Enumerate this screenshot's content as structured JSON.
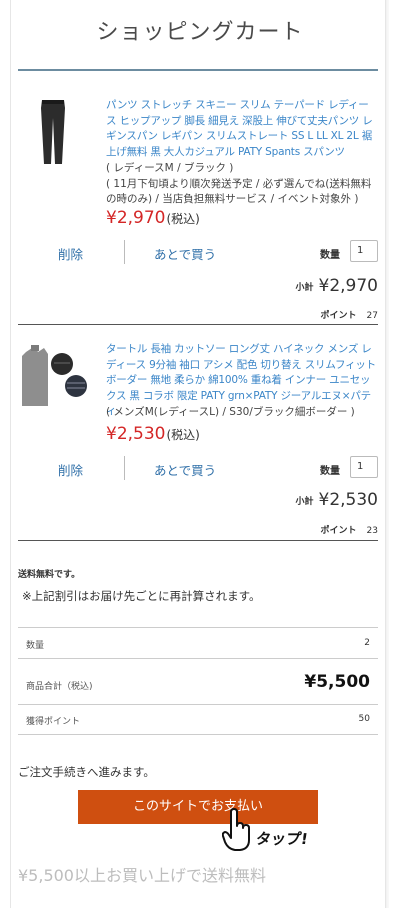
{
  "page": {
    "title": "ショッピングカート"
  },
  "items": [
    {
      "name": "パンツ ストレッチ スキニー スリム テーパード レディース ヒップアップ 脚長 細見え 深股上 伸びて丈夫パンツ レギンスパン レギパン スリムストレート SS L LL XL 2L 裾上げ無料 黒 大人カジュアル PATY Spants スパンツ",
      "spec_lines": [
        "( レディースM / ブラック )",
        "( 11月下旬頃より順次発送予定 / 必ず選んでね(送料無料の時のみ) / 当店負担無料サービス / イベント対象外 )"
      ],
      "price": "¥2,970",
      "tax_label": "(税込)",
      "delete_label": "削除",
      "later_label": "あとで買う",
      "qty_label": "数量",
      "qty": "1",
      "subtotal_label": "小計",
      "subtotal": "¥2,970",
      "points_label": "ポイント",
      "points": "27"
    },
    {
      "name": "タートル 長袖 カットソー ロング丈 ハイネック メンズ レディース 9分袖 袖口 アシメ 配色 切り替え スリムフィット ボーダー 無地 柔らか 綿100% 重ね着 インナー ユニセックス 黒 コラボ 限定 PATY grn×PATY ジーアルエヌ×パティ",
      "spec_lines": [
        "( メンズM(レディースL) / S30/ブラック細ボーダー )"
      ],
      "price": "¥2,530",
      "tax_label": "(税込)",
      "delete_label": "削除",
      "later_label": "あとで買う",
      "qty_label": "数量",
      "qty": "1",
      "subtotal_label": "小計",
      "subtotal": "¥2,530",
      "points_label": "ポイント",
      "points": "23"
    }
  ],
  "summary": {
    "free_shipping_note": "送料無料です。",
    "recalc_note": "※上記割引はお届け先ごとに再計算されます。",
    "qty_label": "数量",
    "qty_value": "2",
    "total_label": "商品合計（税込)",
    "total_value": "¥5,500",
    "points_label": "獲得ポイント",
    "points_value": "50"
  },
  "checkout": {
    "proceed_text": "ご注文手続きへ進みます。",
    "pay_button_label": "このサイトでお支払い",
    "tap_text": "タップ!"
  },
  "promo_text": "¥5,500以上お買い上げで送料無料",
  "colors": {
    "link": "#3b86c8",
    "price": "#d42626",
    "pay_button": "#cf4f10"
  }
}
